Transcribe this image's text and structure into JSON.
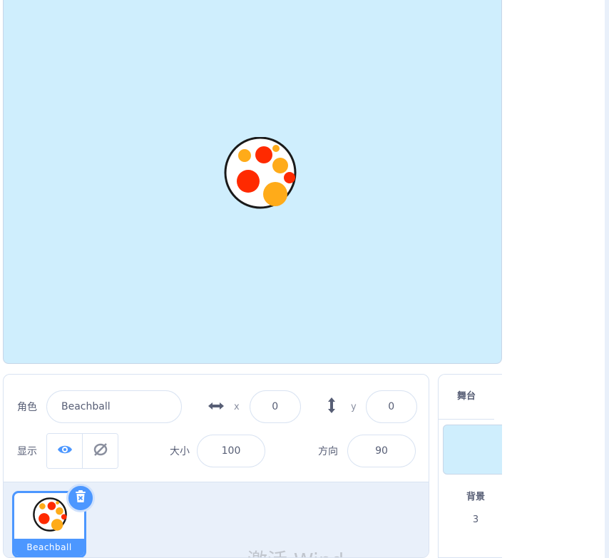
{
  "stage": {
    "sprite_icon": "beachball-sprite"
  },
  "sprite_info": {
    "sprite_label": "角色",
    "sprite_name": "Beachball",
    "x_icon": "horizontal-arrows-icon",
    "x_label": "x",
    "x_value": "0",
    "y_icon": "vertical-arrows-icon",
    "y_label": "y",
    "y_value": "0",
    "show_label": "显示",
    "show_icon": "eye-icon",
    "hide_icon": "eye-slash-icon",
    "size_label": "大小",
    "size_value": "100",
    "direction_label": "方向",
    "direction_value": "90"
  },
  "sprite_list": {
    "sprites": [
      {
        "name": "Beachball",
        "selected": true
      }
    ],
    "delete_icon": "trash-icon",
    "watermark": "激活 Wind"
  },
  "stage_pane": {
    "title": "舞台",
    "backdrops_label": "背景",
    "backdrops_count": "3"
  },
  "colors": {
    "stage_bg": "#cfeefd",
    "accent": "#4c97ff",
    "text": "#575e75",
    "ball_red": "#ff2a00",
    "ball_orange": "#ffab19"
  }
}
